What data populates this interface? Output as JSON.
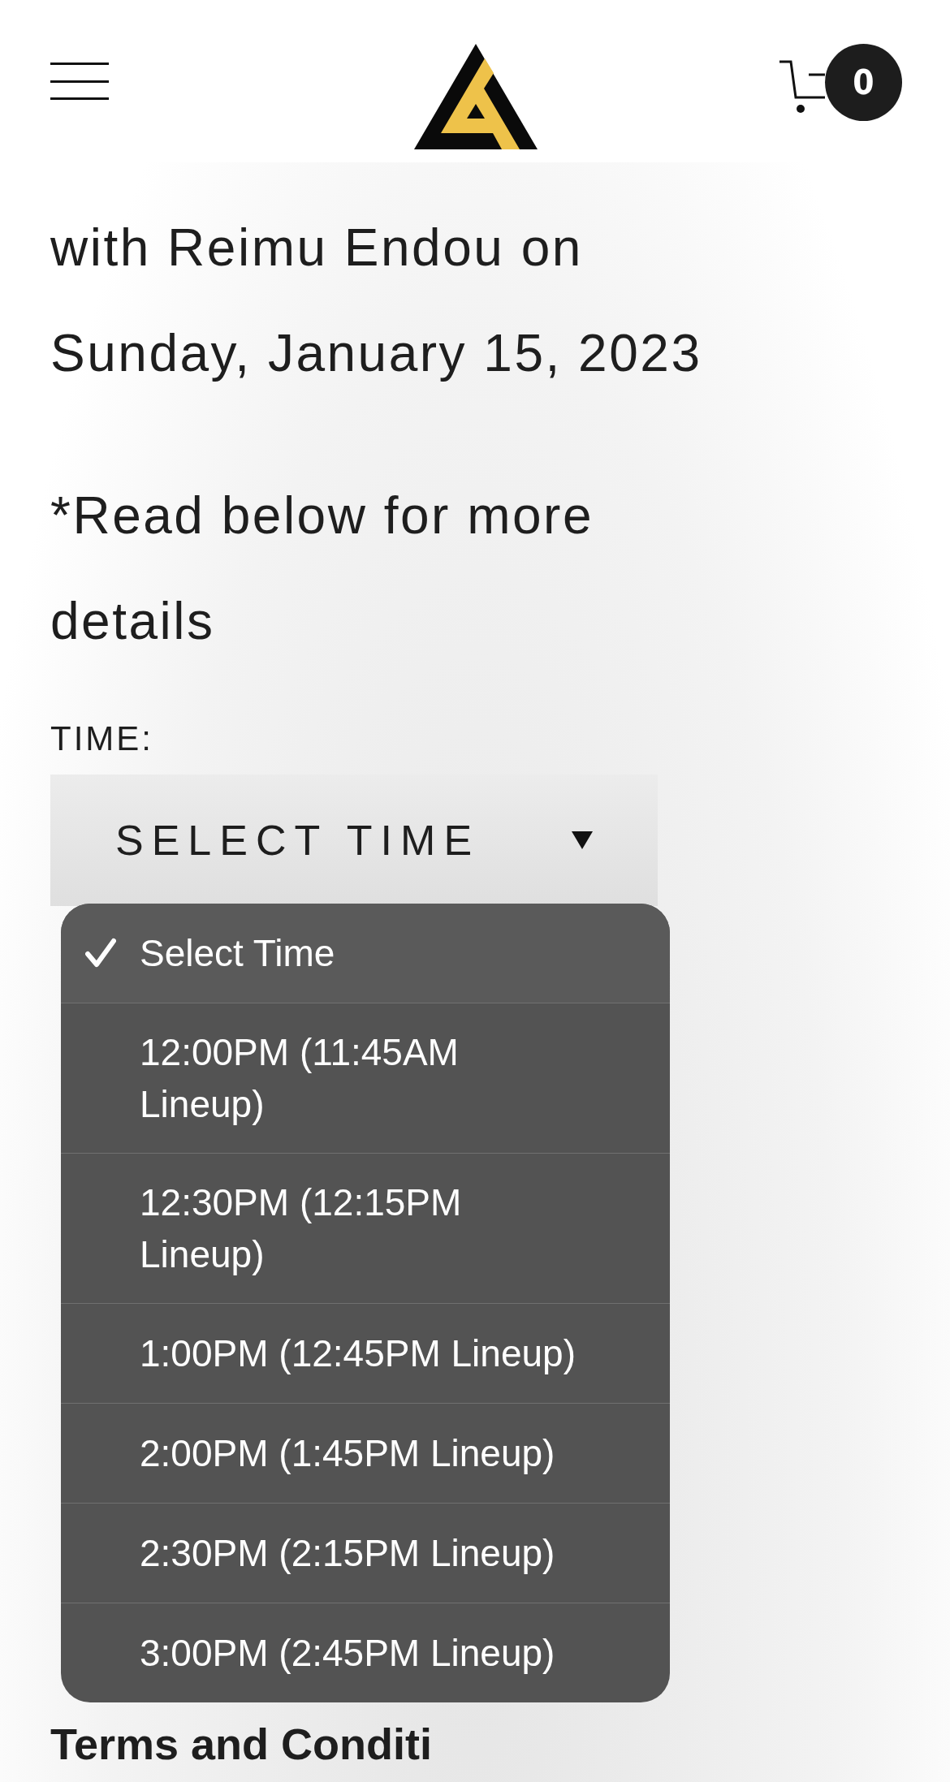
{
  "header": {
    "cart_count": "0"
  },
  "intro_lines": [
    "with Reimu Endou on",
    "Sunday, January 15, 2023"
  ],
  "note_lines": [
    "*Read below for more",
    "details"
  ],
  "time_field": {
    "label": "TIME:",
    "value": "SELECT TIME"
  },
  "dropdown": {
    "options": [
      {
        "label": "Select Time",
        "selected": true
      },
      {
        "label": "12:00PM (11:45AM Lineup)",
        "selected": false
      },
      {
        "label": "12:30PM (12:15PM Lineup)",
        "selected": false
      },
      {
        "label": "1:00PM (12:45PM Lineup)",
        "selected": false
      },
      {
        "label": "2:00PM (1:45PM Lineup)",
        "selected": false
      },
      {
        "label": "2:30PM (2:15PM Lineup)",
        "selected": false
      },
      {
        "label": "3:00PM (2:45PM Lineup)",
        "selected": false
      }
    ]
  },
  "section_heading": "Terms and Conditi"
}
